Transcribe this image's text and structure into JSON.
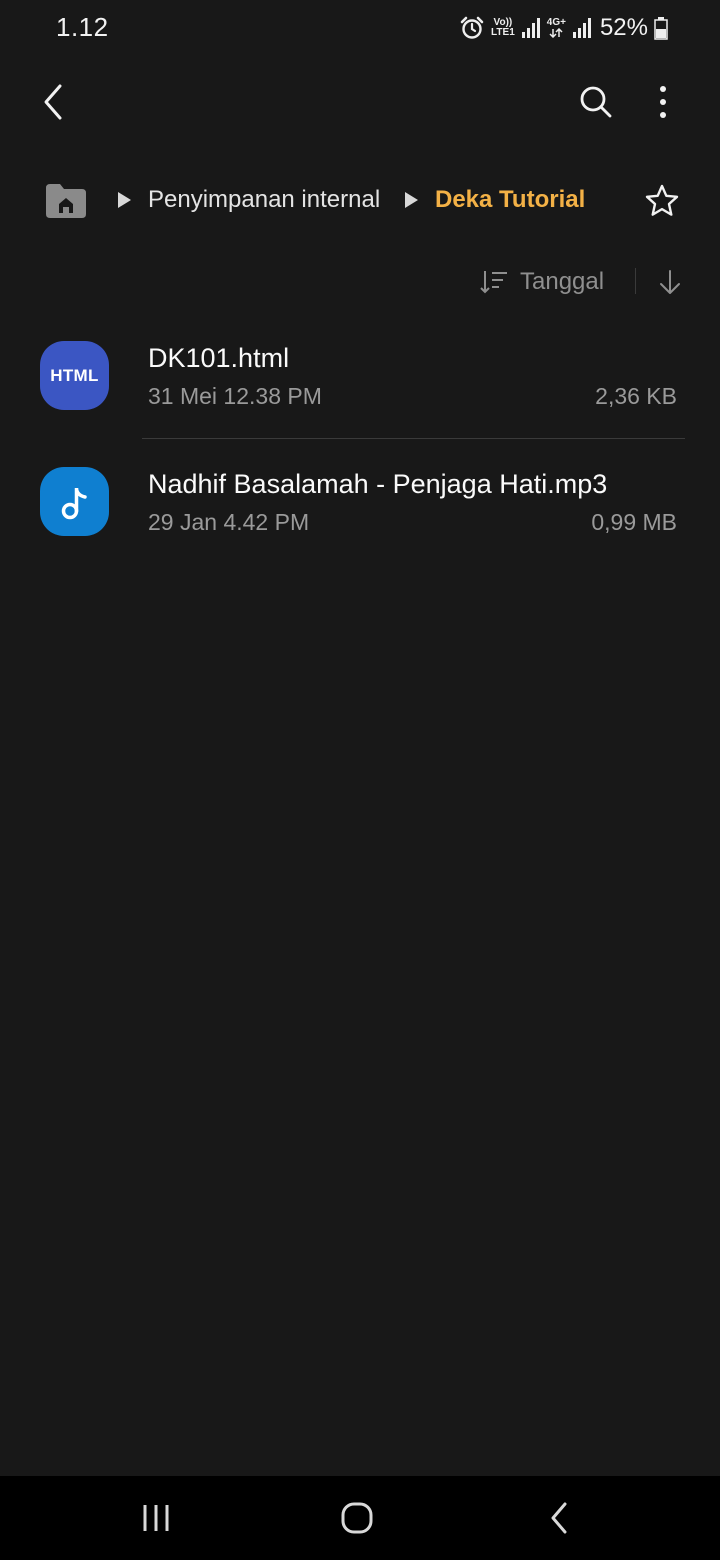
{
  "status_bar": {
    "time": "1.12",
    "volte_label": "Vo))",
    "lte_label": "LTE1",
    "network_label": "4G+",
    "battery_percent": "52%"
  },
  "app_bar": {
    "icons": [
      "back-arrow-icon",
      "search-icon",
      "more-vert-icon"
    ]
  },
  "breadcrumb": {
    "items": [
      {
        "label": "Penyimpanan internal",
        "active": false
      },
      {
        "label": "Deka Tutorial",
        "active": true
      }
    ],
    "active_color": "#f3b146"
  },
  "sort": {
    "label": "Tanggal",
    "direction": "descending"
  },
  "files": [
    {
      "name": "DK101.html",
      "date": "31 Mei 12.38 PM",
      "size": "2,36 KB",
      "icon": "html-file-icon",
      "icon_label": "HTML",
      "icon_color": "#3b56c3"
    },
    {
      "name": "Nadhif Basalamah - Penjaga Hati.mp3",
      "date": "29 Jan 4.42 PM",
      "size": "0,99 MB",
      "icon": "music-note-icon",
      "icon_color": "#0f7fd0"
    }
  ],
  "nav_bar": {
    "icons": [
      "recent-apps-icon",
      "home-icon",
      "back-icon"
    ]
  }
}
